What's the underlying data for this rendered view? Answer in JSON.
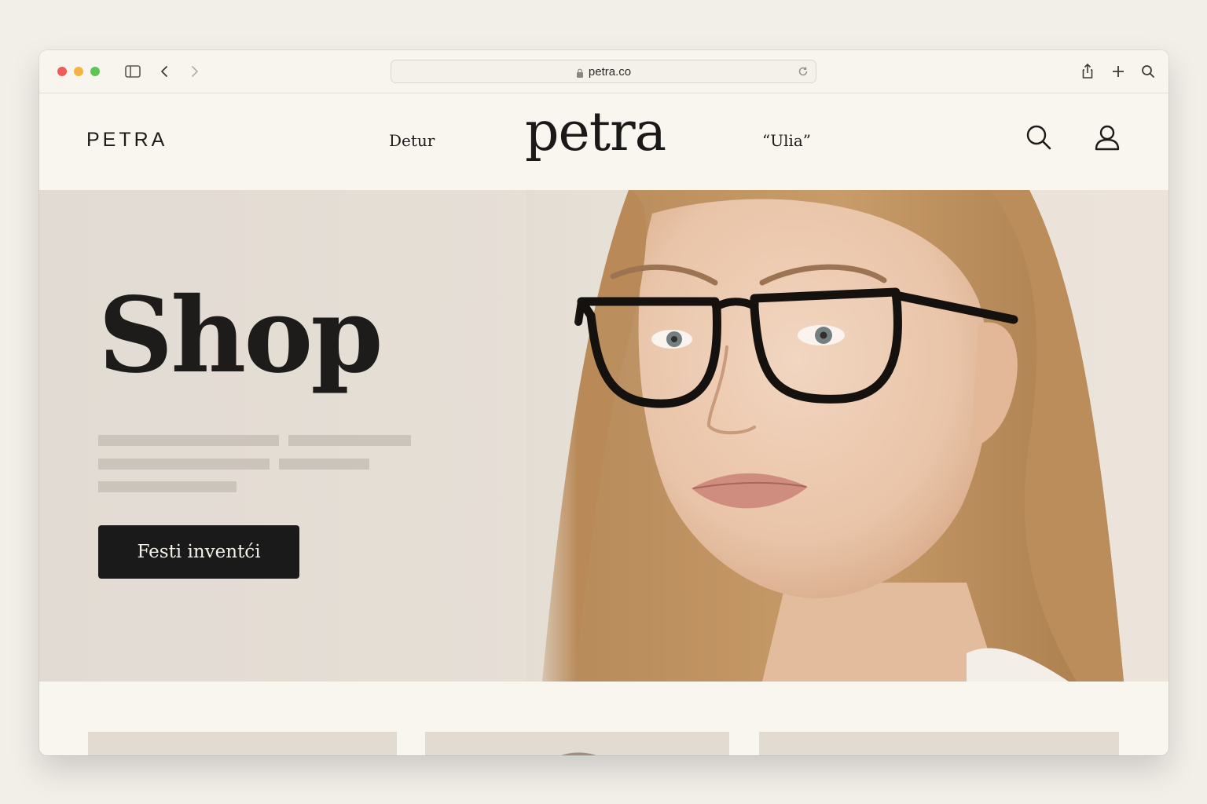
{
  "browser": {
    "url": "petra.co"
  },
  "header": {
    "brand_small": "PETRA",
    "brand_center": "petra",
    "nav": [
      "Detur",
      "“Ulia”"
    ]
  },
  "hero": {
    "title": "Shop",
    "cta_label": "Festi inventći"
  },
  "colors": {
    "accent": "#1a1a1a",
    "page_bg": "#f9f5ef",
    "hero_bg": "#e4ddd4",
    "placeholder": "#cbc4bb"
  },
  "icons": [
    "sidebar-icon",
    "back-icon",
    "forward-icon",
    "lock-icon",
    "reload-icon",
    "share-icon",
    "new-tab-icon",
    "search-icon",
    "account-icon"
  ]
}
